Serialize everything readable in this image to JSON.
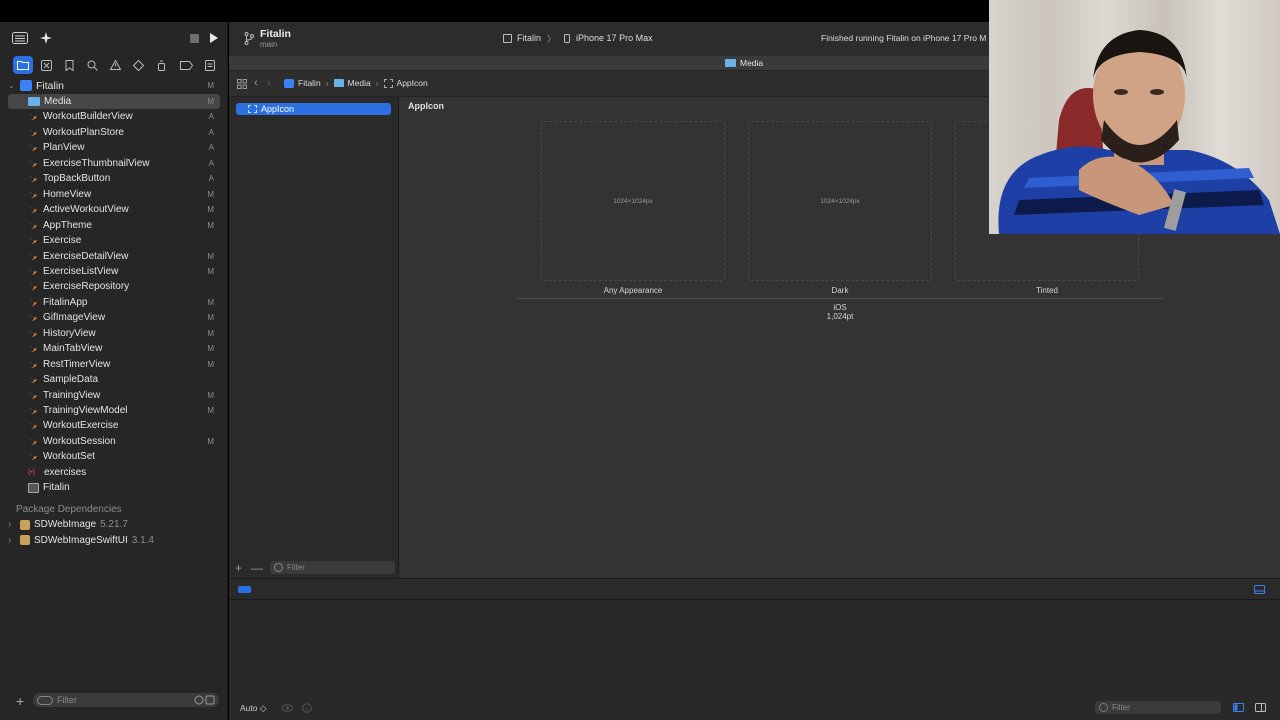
{
  "toolbar": {
    "project_name": "Fitalin",
    "branch": "main",
    "scheme": "Fitalin",
    "destination": "iPhone 17 Pro Max",
    "status_text": "Finished running Fitalin on iPhone 17 Pro M"
  },
  "tab": {
    "label": "Media"
  },
  "jumpbar": {
    "crumbs": [
      "Fitalin",
      "Media",
      "AppIcon"
    ]
  },
  "navigator": {
    "project": {
      "label": "Fitalin",
      "badge": "M"
    },
    "items": [
      {
        "label": "Media",
        "badge": "M",
        "icon": "asset-catalog-icon"
      },
      {
        "label": "WorkoutBuilderView",
        "badge": "A",
        "icon": "swift-file-icon"
      },
      {
        "label": "WorkoutPlanStore",
        "badge": "A",
        "icon": "swift-file-icon"
      },
      {
        "label": "PlanView",
        "badge": "A",
        "icon": "swift-file-icon"
      },
      {
        "label": "ExerciseThumbnailView",
        "badge": "A",
        "icon": "swift-file-icon"
      },
      {
        "label": "TopBackButton",
        "badge": "A",
        "icon": "swift-file-icon"
      },
      {
        "label": "HomeView",
        "badge": "M",
        "icon": "swift-file-icon"
      },
      {
        "label": "ActiveWorkoutView",
        "badge": "M",
        "icon": "swift-file-icon"
      },
      {
        "label": "AppTheme",
        "badge": "M",
        "icon": "swift-file-icon"
      },
      {
        "label": "Exercise",
        "badge": "",
        "icon": "swift-file-icon"
      },
      {
        "label": "ExerciseDetailView",
        "badge": "M",
        "icon": "swift-file-icon"
      },
      {
        "label": "ExerciseListView",
        "badge": "M",
        "icon": "swift-file-icon"
      },
      {
        "label": "ExerciseRepository",
        "badge": "",
        "icon": "swift-file-icon"
      },
      {
        "label": "FitalinApp",
        "badge": "M",
        "icon": "swift-file-icon"
      },
      {
        "label": "GifImageView",
        "badge": "M",
        "icon": "swift-file-icon"
      },
      {
        "label": "HistoryView",
        "badge": "M",
        "icon": "swift-file-icon"
      },
      {
        "label": "MainTabView",
        "badge": "M",
        "icon": "swift-file-icon"
      },
      {
        "label": "RestTimerView",
        "badge": "M",
        "icon": "swift-file-icon"
      },
      {
        "label": "SampleData",
        "badge": "",
        "icon": "swift-file-icon"
      },
      {
        "label": "TrainingView",
        "badge": "M",
        "icon": "swift-file-icon"
      },
      {
        "label": "TrainingViewModel",
        "badge": "M",
        "icon": "swift-file-icon"
      },
      {
        "label": "WorkoutExercise",
        "badge": "",
        "icon": "swift-file-icon"
      },
      {
        "label": "WorkoutSession",
        "badge": "M",
        "icon": "swift-file-icon"
      },
      {
        "label": "WorkoutSet",
        "badge": "",
        "icon": "swift-file-icon"
      },
      {
        "label": "exercises",
        "badge": "",
        "icon": "json-file-icon"
      },
      {
        "label": "Fitalin",
        "badge": "",
        "icon": "plist-file-icon"
      }
    ],
    "packages_header": "Package Dependencies",
    "packages": [
      {
        "name": "SDWebImage",
        "version": "5.21.7"
      },
      {
        "name": "SDWebImageSwiftUI",
        "version": "3.1.4"
      }
    ],
    "filter_placeholder": "Filter"
  },
  "asset_list": {
    "items": [
      {
        "label": "AppIcon"
      }
    ],
    "filter_placeholder": "Filter"
  },
  "asset_detail": {
    "title": "AppIcon",
    "slots": [
      {
        "size": "1024×1024px",
        "label": "Any Appearance"
      },
      {
        "size": "1024×1024px",
        "label": "Dark"
      },
      {
        "size": "",
        "label": "Tinted"
      }
    ],
    "platform": "iOS",
    "point_size": "1,024pt"
  },
  "debug": {
    "auto_label": "Auto ◇",
    "filter_placeholder": "Filter"
  },
  "colors": {
    "accent": "#2b6fe0",
    "swift": "#f0853a",
    "sidebar_bg": "#262626",
    "editor_bg": "#333333"
  }
}
